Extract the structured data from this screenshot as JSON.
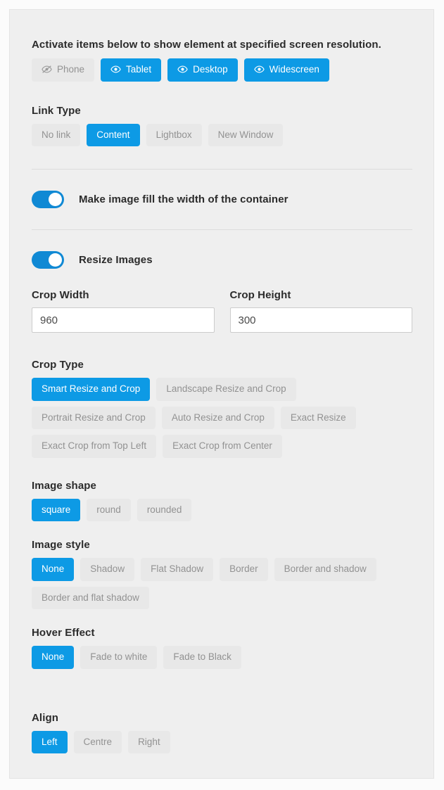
{
  "panel": {
    "resolution": {
      "intro": "Activate items below to show element at specified screen resolution.",
      "buttons": [
        {
          "label": "Phone",
          "icon": "eye-slash-icon",
          "active": false
        },
        {
          "label": "Tablet",
          "icon": "eye-icon",
          "active": true
        },
        {
          "label": "Desktop",
          "icon": "eye-icon",
          "active": true
        },
        {
          "label": "Widescreen",
          "icon": "eye-icon",
          "active": true
        }
      ]
    },
    "link_type": {
      "label": "Link Type",
      "options": [
        {
          "label": "No link",
          "active": false
        },
        {
          "label": "Content",
          "active": true
        },
        {
          "label": "Lightbox",
          "active": false
        },
        {
          "label": "New Window",
          "active": false
        }
      ]
    },
    "fill_width": {
      "label": "Make image fill the width of the container",
      "enabled": true
    },
    "resize_images": {
      "label": "Resize Images",
      "enabled": true
    },
    "crop_width": {
      "label": "Crop Width",
      "value": "960"
    },
    "crop_height": {
      "label": "Crop Height",
      "value": "300"
    },
    "crop_type": {
      "label": "Crop Type",
      "options": [
        {
          "label": "Smart Resize and Crop",
          "active": true
        },
        {
          "label": "Landscape Resize and Crop",
          "active": false
        },
        {
          "label": "Portrait Resize and Crop",
          "active": false
        },
        {
          "label": "Auto Resize and Crop",
          "active": false
        },
        {
          "label": "Exact Resize",
          "active": false
        },
        {
          "label": "Exact Crop from Top Left",
          "active": false
        },
        {
          "label": "Exact Crop from Center",
          "active": false
        }
      ]
    },
    "image_shape": {
      "label": "Image shape",
      "options": [
        {
          "label": "square",
          "active": true
        },
        {
          "label": "round",
          "active": false
        },
        {
          "label": "rounded",
          "active": false
        }
      ]
    },
    "image_style": {
      "label": "Image style",
      "options": [
        {
          "label": "None",
          "active": true
        },
        {
          "label": "Shadow",
          "active": false
        },
        {
          "label": "Flat Shadow",
          "active": false
        },
        {
          "label": "Border",
          "active": false
        },
        {
          "label": "Border and shadow",
          "active": false
        },
        {
          "label": "Border and flat shadow",
          "active": false
        }
      ]
    },
    "hover_effect": {
      "label": "Hover Effect",
      "options": [
        {
          "label": "None",
          "active": true
        },
        {
          "label": "Fade to white",
          "active": false
        },
        {
          "label": "Fade to Black",
          "active": false
        }
      ]
    },
    "align": {
      "label": "Align",
      "options": [
        {
          "label": "Left",
          "active": true
        },
        {
          "label": "Centre",
          "active": false
        },
        {
          "label": "Right",
          "active": false
        }
      ]
    }
  },
  "colors": {
    "accent": "#0d9ae5",
    "toggle_on": "#1089d4",
    "pill_bg": "#e8e8e8",
    "pill_text": "#929292",
    "panel_bg": "#efefef"
  }
}
